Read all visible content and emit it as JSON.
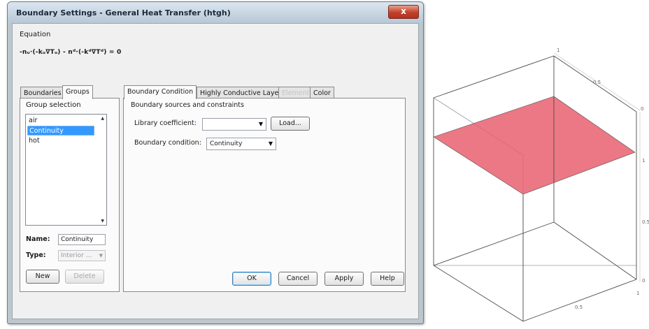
{
  "window": {
    "title": "Boundary Settings - General Heat Transfer (htgh)",
    "close_glyph": "x"
  },
  "equation": {
    "label": "Equation",
    "text": "-nᵤ·(-kᵤ∇Tᵤ) - nᵈ·(-kᵈ∇Tᵈ) = 0"
  },
  "left_tabs": [
    "Boundaries",
    "Groups"
  ],
  "group_selection": {
    "label": "Group selection",
    "items": [
      "air",
      "Continuity",
      "hot"
    ],
    "selected_index": 1
  },
  "group_fields": {
    "name_label": "Name:",
    "name_value": "Continuity",
    "type_label": "Type:",
    "type_value": "Interior ..."
  },
  "group_buttons": {
    "new": "New",
    "delete": "Delete"
  },
  "right_tabs": [
    "Boundary Condition",
    "Highly Conductive Layer",
    "Element",
    "Color"
  ],
  "boundary": {
    "section_title": "Boundary sources and constraints",
    "library_label": "Library coefficient:",
    "library_value": "",
    "load_button": "Load...",
    "condition_label": "Boundary condition:",
    "condition_value": "Continuity"
  },
  "footer_buttons": {
    "ok": "OK",
    "cancel": "Cancel",
    "apply": "Apply",
    "help": "Help"
  },
  "plot": {
    "tick_labels": [
      "1",
      "0.5",
      "0",
      "1",
      "0.5",
      "0",
      "0.5",
      "1"
    ],
    "plane_color": "#e8606e",
    "edge_color": "#555555"
  }
}
